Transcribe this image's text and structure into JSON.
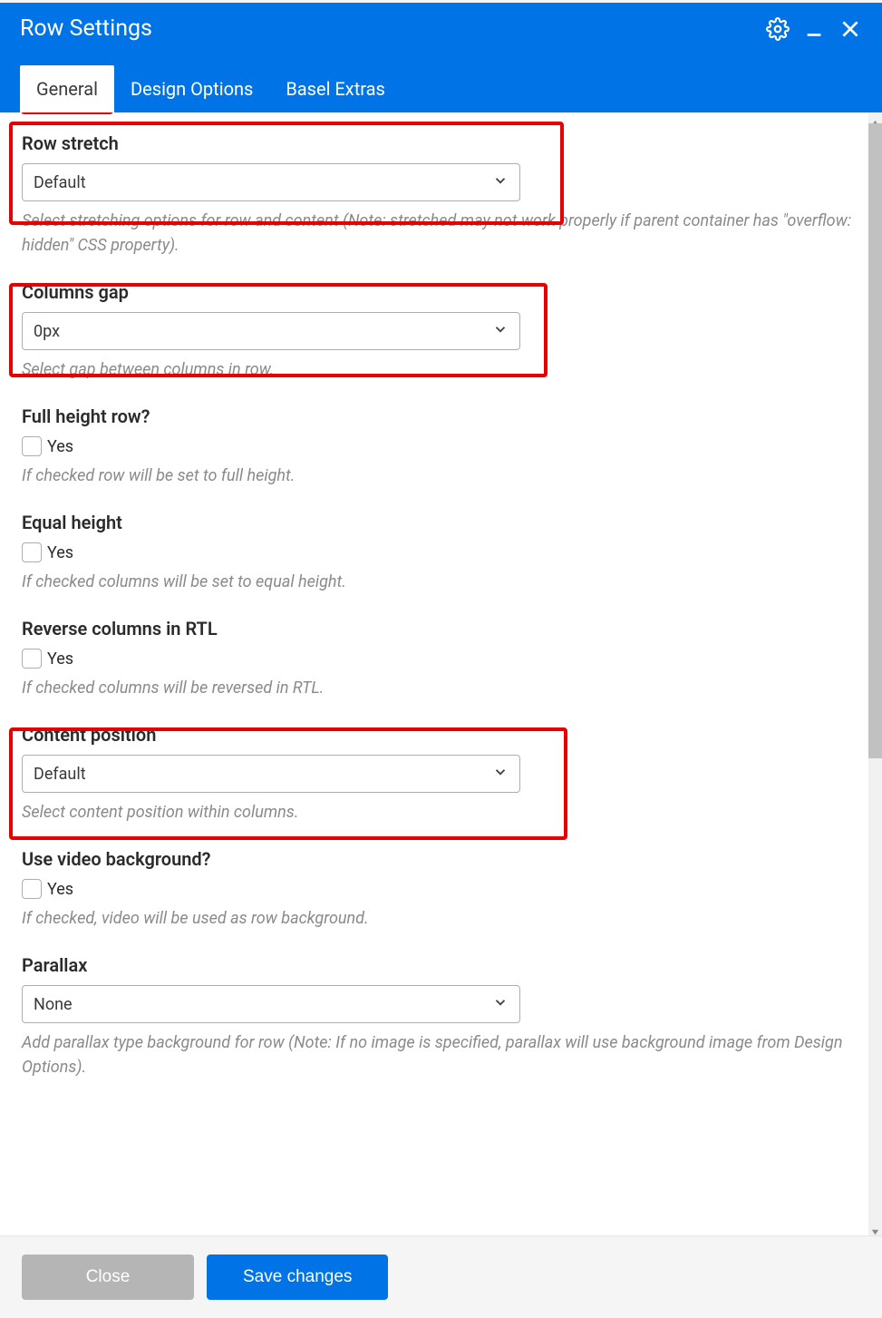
{
  "header": {
    "title": "Row Settings"
  },
  "tabs": {
    "general": "General",
    "design": "Design Options",
    "basel": "Basel Extras"
  },
  "fields": {
    "row_stretch": {
      "label": "Row stretch",
      "value": "Default",
      "desc": "Select stretching options for row and content (Note: stretched may not work properly if parent container has \"overflow: hidden\" CSS property)."
    },
    "columns_gap": {
      "label": "Columns gap",
      "value": "0px",
      "desc": "Select gap between columns in row."
    },
    "full_height": {
      "label": "Full height row?",
      "option": "Yes",
      "desc": "If checked row will be set to full height."
    },
    "equal_height": {
      "label": "Equal height",
      "option": "Yes",
      "desc": "If checked columns will be set to equal height."
    },
    "reverse_rtl": {
      "label": "Reverse columns in RTL",
      "option": "Yes",
      "desc": "If checked columns will be reversed in RTL."
    },
    "content_position": {
      "label": "Content position",
      "value": "Default",
      "desc": "Select content position within columns."
    },
    "video_bg": {
      "label": "Use video background?",
      "option": "Yes",
      "desc": "If checked, video will be used as row background."
    },
    "parallax": {
      "label": "Parallax",
      "value": "None",
      "desc": "Add parallax type background for row (Note: If no image is specified, parallax will use background image from Design Options)."
    }
  },
  "footer": {
    "close": "Close",
    "save": "Save changes"
  }
}
